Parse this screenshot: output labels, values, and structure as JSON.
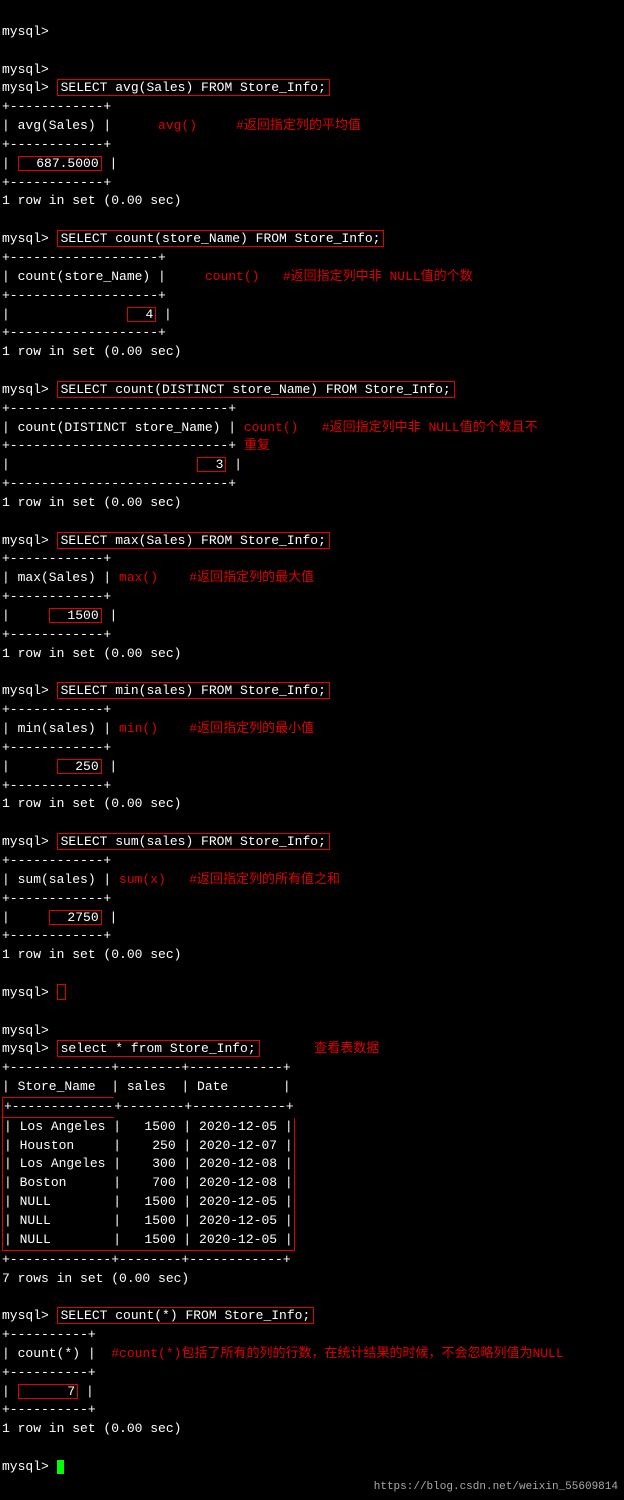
{
  "prompt": "mysql>",
  "watermark": "https://blog.csdn.net/weixin_55609814",
  "rows_in_set": "1 row in set (0.00 sec)",
  "rows_7": "7 rows in set (0.00 sec)",
  "q1": {
    "sql": "SELECT avg(Sales) FROM Store_Info;",
    "sep": "+------------+",
    "col": "| avg(Sales) |",
    "val": "687.5000",
    "func": "avg()",
    "note": "#返回指定列的平均值"
  },
  "q2": {
    "sql": "SELECT count(store_Name) FROM Store_Info;",
    "sep": "+-------------------+",
    "col": "| count(store_Name) |",
    "val": "4",
    "func": "count()",
    "note": "#返回指定列中非 NULL值的个数"
  },
  "q3": {
    "sql": "SELECT count(DISTINCT store_Name) FROM Store_Info;",
    "sep": "+----------------------------+",
    "col": "| count(DISTINCT store_Name) |",
    "val": "3",
    "func": "count()",
    "note1": "#返回指定列中非 NULL值的个数且不",
    "note2": "重复"
  },
  "q4": {
    "sql": "SELECT max(Sales) FROM Store_Info;",
    "sep": "+------------+",
    "col": "| max(Sales) |",
    "val": "1500",
    "func": "max()",
    "note": "#返回指定列的最大值"
  },
  "q5": {
    "sql": "SELECT min(sales) FROM Store_Info;",
    "sep": "+------------+",
    "col": "| min(sales) |",
    "val": "250",
    "func": "min()",
    "note": "#返回指定列的最小值"
  },
  "q6": {
    "sql": "SELECT sum(sales) FROM Store_Info;",
    "sep": "+------------+",
    "col": "| sum(sales) |",
    "val": "2750",
    "func": "sum(x)",
    "note": "#返回指定列的所有值之和"
  },
  "q7": {
    "sql": "select * from Store_Info;",
    "note": "查看表数据",
    "sep": "+-------------+--------+------------+",
    "hdr": "| Store_Name  | sales  | Date       |",
    "rows": [
      "Los Angeles |   1500 | 2020-12-05 |",
      "Houston     |    250 | 2020-12-07 |",
      "Los Angeles |    300 | 2020-12-08 |",
      "Boston      |    700 | 2020-12-08 |",
      "NULL        |   1500 | 2020-12-05 |",
      "NULL        |   1500 | 2020-12-05 |",
      "NULL        |   1500 | 2020-12-05 |"
    ]
  },
  "q8": {
    "sql": "SELECT count(*) FROM Store_Info;",
    "sep": "+----------+",
    "col": "| count(*) |",
    "val": "7",
    "note": "#count(*)包括了所有的列的行数，在统计结果的时候，不会忽略列值为NULL"
  }
}
